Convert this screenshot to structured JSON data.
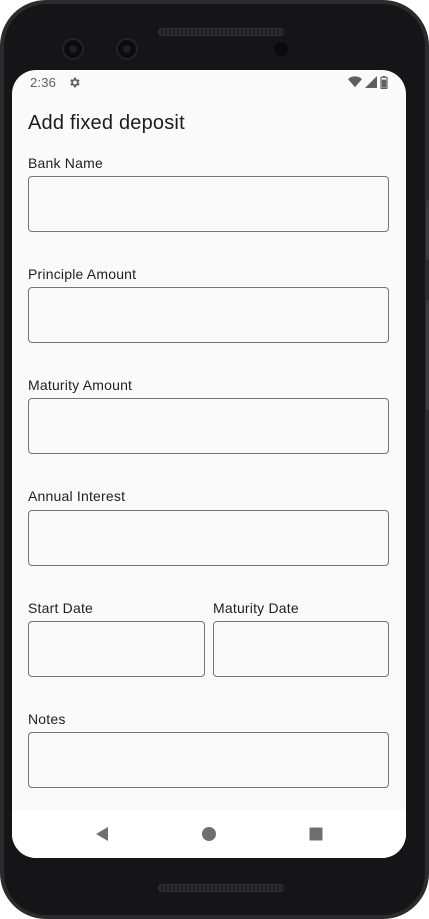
{
  "status_bar": {
    "time": "2:36",
    "icons": [
      "settings-gear-icon",
      "wifi-icon",
      "cellular-signal-icon",
      "battery-icon"
    ]
  },
  "page": {
    "title": "Add fixed deposit"
  },
  "form": {
    "bank_name": {
      "label": "Bank Name",
      "value": ""
    },
    "principal_amount": {
      "label": "Principle Amount",
      "value": ""
    },
    "maturity_amount": {
      "label": "Maturity Amount",
      "value": ""
    },
    "annual_interest": {
      "label": "Annual Interest",
      "value": ""
    },
    "start_date": {
      "label": "Start Date",
      "value": ""
    },
    "maturity_date": {
      "label": "Maturity Date",
      "value": ""
    },
    "notes": {
      "label": "Notes",
      "value": ""
    }
  },
  "nav_bar": {
    "buttons": [
      "back-icon",
      "home-icon",
      "recents-icon"
    ]
  },
  "colors": {
    "screen_background": "#fafafa",
    "input_border": "#747474",
    "nav_icon": "#6f6f6f",
    "device_frame": "#151517"
  }
}
